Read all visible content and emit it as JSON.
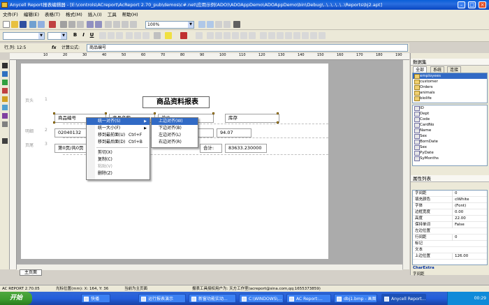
{
  "window": {
    "title": "Anycell Report报表编辑器 - [E:\\controls\\ACreport\\AcReport 2.70_pub\\demos\\c#.net\\应用示例(ADO)\\ADOAppDemo\\ADOAppDemo\\bin\\Debug\\..\\..\\..\\..\\..\\Reports\\bj2.apt]"
  },
  "menu": [
    "文件(F)",
    "编辑(E)",
    "表格(T)",
    "格式(M)",
    "插入(I)",
    "工具",
    "帮助(H)"
  ],
  "toolbar": {
    "zoom": "100%",
    "bold": "B",
    "italic": "I",
    "underline": "U"
  },
  "formula": {
    "cell_ref": "行,列: 12:5",
    "fx": "fx",
    "label": "计算公式:",
    "value": "商品编号"
  },
  "ruler": [
    "10",
    "20",
    "30",
    "40",
    "50",
    "60",
    "70",
    "80",
    "90",
    "100",
    "110",
    "120",
    "130",
    "140",
    "150",
    "160",
    "170",
    "180",
    "190"
  ],
  "bands": {
    "title": "页头",
    "detail": "明细",
    "footer": "页尾",
    "n1": "1",
    "n2": "2",
    "n3": "3"
  },
  "report": {
    "title": "商品资料报表",
    "headers": [
      "商品编号",
      "商品名称",
      "单价",
      "库存"
    ],
    "row": [
      "02040132",
      "",
      "94.07"
    ],
    "footer_page": "第0页/共0页",
    "total_label": "合计:",
    "total_value": "83633.230000"
  },
  "context_menu": {
    "items": [
      {
        "label": "统一对齐(S)",
        "shortcut": "",
        "arrow": "▶"
      },
      {
        "label": "统一大小(F)",
        "shortcut": "",
        "arrow": "▶"
      },
      {
        "label": "移到最前面(U)",
        "shortcut": "Ctrl+F",
        "arrow": ""
      },
      {
        "label": "移到最后面(D)",
        "shortcut": "Ctrl+B",
        "arrow": ""
      },
      {
        "label": "剪切(X)",
        "shortcut": "",
        "arrow": ""
      },
      {
        "label": "复制(C)",
        "shortcut": "",
        "arrow": ""
      },
      {
        "label": "粘贴(V)",
        "shortcut": "",
        "arrow": ""
      },
      {
        "label": "删除(Z)",
        "shortcut": "",
        "arrow": ""
      }
    ],
    "submenu": [
      "上边对齐(W)",
      "下边对齐(B)",
      "左边对齐(L)",
      "右边对齐(R)"
    ]
  },
  "dataset": {
    "header": "数据集",
    "tabs": [
      "全部",
      "系统",
      "连接"
    ],
    "tables": [
      "employees",
      "customer",
      "Orders",
      "animals",
      "biolife"
    ],
    "fields": [
      "ID",
      "Dept",
      "Code",
      "CardNo",
      "Name",
      "Sex",
      "BornDate",
      "Sex",
      "PyDate",
      "SyMonths"
    ]
  },
  "properties": {
    "header": "属性列表",
    "rows": [
      {
        "k": "字间距",
        "v": "0"
      },
      {
        "k": "填充颜色",
        "v": "clWhite"
      },
      {
        "k": "字体",
        "v": "(Font)"
      },
      {
        "k": "边框宽度",
        "v": "0.00"
      },
      {
        "k": "高度",
        "v": "22.00"
      },
      {
        "k": "保持单词",
        "v": "False"
      },
      {
        "k": "左边位置",
        "v": ""
      },
      {
        "k": "行间距",
        "v": "0"
      },
      {
        "k": "标记",
        "v": ""
      },
      {
        "k": "文本",
        "v": ""
      },
      {
        "k": "上边位置",
        "v": "126.00"
      }
    ],
    "desc_title": "CharExtra",
    "desc": "字间距"
  },
  "sheet_tab": "主页面",
  "status": {
    "version": "AC REPORT 2.70.05",
    "cursor": "光标位置(mm): X: 164, Y: 36",
    "page": "当前为主页面",
    "author": "报表工具授权用户为: 天方工作室(acreport@sina.com,qq:1655373859)"
  },
  "taskbar": {
    "start": "开始",
    "tasks": [
      "快播",
      "运行报表演示",
      "新窗功能实动...",
      "C:\\WINDOWS\\...",
      "AC Report:...",
      "dbj1.bmp - 画图",
      "Anycell Report..."
    ],
    "clock": "00:29"
  }
}
